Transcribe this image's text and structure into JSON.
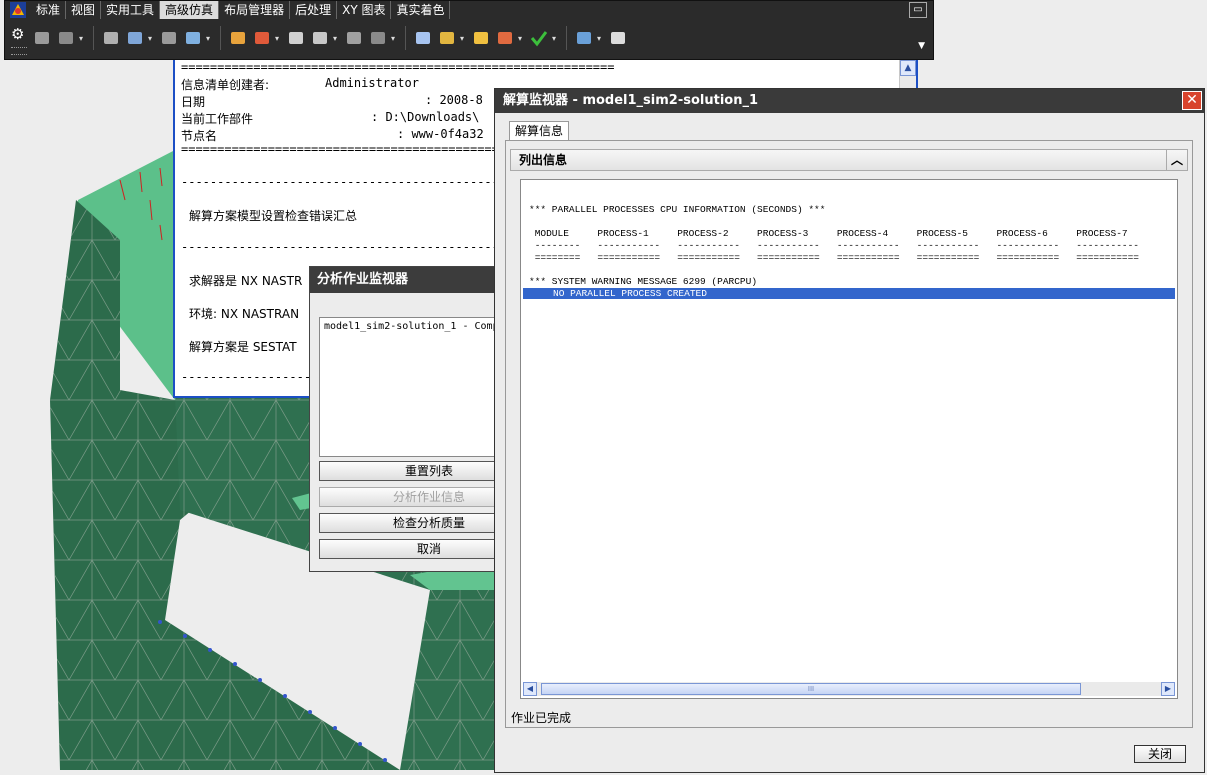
{
  "menu": {
    "tabs": [
      {
        "label": "标准",
        "active": false
      },
      {
        "label": "视图",
        "active": false
      },
      {
        "label": "实用工具",
        "active": false
      },
      {
        "label": "高级仿真",
        "active": true
      },
      {
        "label": "布局管理器",
        "active": false
      },
      {
        "label": "后处理",
        "active": false
      },
      {
        "label": "XY 图表",
        "active": false
      },
      {
        "label": "真实着色",
        "active": false
      }
    ]
  },
  "toolbar": {
    "icons": [
      "part-icon",
      "assembly-icon",
      "mesh-icon",
      "element-icon",
      "grid-icon",
      "table-icon",
      "load-icon",
      "constraint-icon",
      "axis-icon",
      "node-icon",
      "solid-icon",
      "surface-icon",
      "material-icon",
      "solve-icon",
      "results-icon",
      "xy-plot-icon",
      "check-icon",
      "report-icon",
      "document-icon"
    ]
  },
  "info_window": {
    "separator_top": "============================================================",
    "creator_label": "信息清单创建者:",
    "creator_value": "Administrator",
    "date_label": "日期",
    "date_value": ": 2008-8",
    "work_part_label": "当前工作部件",
    "work_part_value": ": D:\\Downloads\\",
    "node_label": "节点名",
    "node_value": ": www-0f4a32",
    "separator_eq": "============================================================",
    "separator_dash": "------------------------------------------------------------",
    "summary_title": "解算方案模型设置检查错误汇总",
    "solver_line": "求解器是 NX NASTR",
    "env_line": "环境: NX NASTRAN",
    "solution_line": "解算方案是 SESTAT"
  },
  "analysis_monitor": {
    "title": "分析作业监视器",
    "list_item": "model1_sim2-solution_1 - Comp",
    "buttons": {
      "reset": "重置列表",
      "job_info": "分析作业信息",
      "check_quality": "检查分析质量",
      "cancel": "取消"
    }
  },
  "solution_monitor": {
    "title": "解算监视器 - model1_sim2-solution_1",
    "tab": "解算信息",
    "group_header": "列出信息",
    "output_lines": [
      {
        "text": "*** PARALLEL PROCESSES CPU INFORMATION (SECONDS) ***",
        "highlight": false
      },
      {
        "text": " MODULE     PROCESS-1     PROCESS-2     PROCESS-3     PROCESS-4     PROCESS-5     PROCESS-6     PROCESS-7",
        "highlight": false
      },
      {
        "text": " --------   -----------   -----------   -----------   -----------   -----------   -----------   -----------",
        "highlight": false
      },
      {
        "text": " ========   ===========   ===========   ===========   ===========   ===========   ===========   ===========",
        "highlight": false
      },
      {
        "text": "*** SYSTEM WARNING MESSAGE 6299 (PARCPU)",
        "highlight": false
      },
      {
        "text": "NO PARALLEL PROCESS CREATED",
        "highlight": true
      }
    ],
    "scroll_thumb_grip": "III",
    "status": "作业已完成",
    "close_button": "关闭"
  }
}
